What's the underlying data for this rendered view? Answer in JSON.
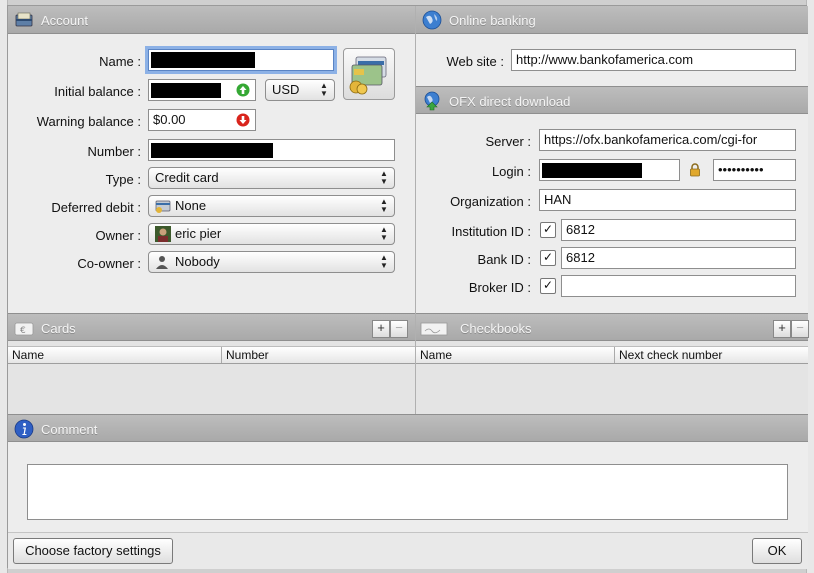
{
  "account": {
    "header": "Account",
    "name_label": "Name :",
    "initial_balance_label": "Initial balance :",
    "currency": "USD",
    "warning_balance_label": "Warning balance :",
    "warning_balance_value": "$0.00",
    "number_label": "Number :",
    "type_label": "Type :",
    "type_value": "Credit card",
    "deferred_label": "Deferred debit :",
    "deferred_value": "None",
    "owner_label": "Owner :",
    "owner_value": "eric pier",
    "coowner_label": "Co-owner :",
    "coowner_value": "Nobody"
  },
  "online": {
    "header": "Online banking",
    "website_label": "Web site :",
    "website_value": "http://www.bankofamerica.com"
  },
  "ofx": {
    "header": "OFX direct download",
    "server_label": "Server :",
    "server_value": "https://ofx.bankofamerica.com/cgi-for",
    "login_label": "Login :",
    "password_value": "••••••••••",
    "org_label": "Organization :",
    "org_value": "HAN",
    "inst_label": "Institution ID :",
    "inst_value": "6812",
    "bank_label": "Bank ID :",
    "bank_value": "6812",
    "broker_label": "Broker ID :",
    "broker_value": ""
  },
  "cards": {
    "header": "Cards",
    "columns": [
      "Name",
      "Number"
    ]
  },
  "checkbooks": {
    "header": "Checkbooks",
    "columns": [
      "Name",
      "Next check number"
    ]
  },
  "comment": {
    "header": "Comment",
    "value": ""
  },
  "footer": {
    "factory_label": "Choose factory settings",
    "ok_label": "OK"
  },
  "symbols": {
    "plus": "+",
    "minus": "−",
    "check": "✓",
    "up": "▲",
    "down": "▼"
  },
  "colors": {
    "header_bg": "#b3b3b3",
    "header_text": "#f4f4f4",
    "focus_ring": "#8cb1e6",
    "green_arrow": "#35a834",
    "red_arrow": "#d9241c"
  }
}
